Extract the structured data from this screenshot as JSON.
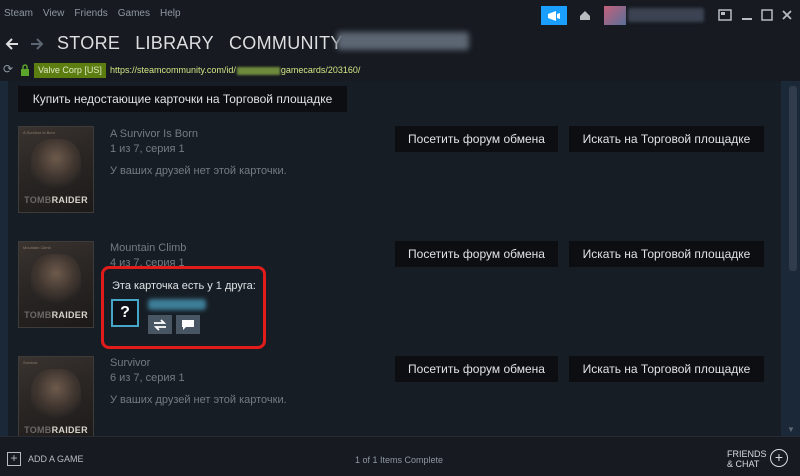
{
  "menu": [
    "Steam",
    "View",
    "Friends",
    "Games",
    "Help"
  ],
  "nav": {
    "back_icon": "arrow-left-icon",
    "forward_icon": "arrow-right-icon",
    "links": [
      "STORE",
      "LIBRARY",
      "COMMUNITY"
    ]
  },
  "urlbar": {
    "cert": "Valve Corp [US]",
    "url_prefix": "https://steamcommunity.com/id/",
    "url_suffix": "gamecards/203160/"
  },
  "content": {
    "buy_button": "Купить недостающие карточки на Торговой площадке",
    "forum_button": "Посетить форум обмена",
    "market_button": "Искать на Торговой площадке",
    "logo_tomb": "TOMB",
    "logo_raider": "RAIDER",
    "cards": [
      {
        "mini": "A Survivor Is Born",
        "title": "A Survivor Is Born",
        "subtitle": "1 из 7, серия 1",
        "note": "У ваших друзей нет этой карточки."
      },
      {
        "mini": "Mountain Climb",
        "title": "Mountain Climb",
        "subtitle": "4 из 7, серия 1",
        "note": ""
      },
      {
        "mini": "Survivor",
        "title": "Survivor",
        "subtitle": "6 из 7, серия 1",
        "note": "У ваших друзей нет этой карточки."
      }
    ],
    "popup": {
      "title": "Эта карточка есть у 1 друга:",
      "avatar_text": "?"
    }
  },
  "bottom": {
    "add_game": "ADD A GAME",
    "status": "1 of 1 Items Complete",
    "friends_line1": "FRIENDS",
    "friends_line2": "& CHAT"
  },
  "colors": {
    "accent": "#1a9fff",
    "highlight": "#e21b1b",
    "cert": "#5c7e10"
  }
}
